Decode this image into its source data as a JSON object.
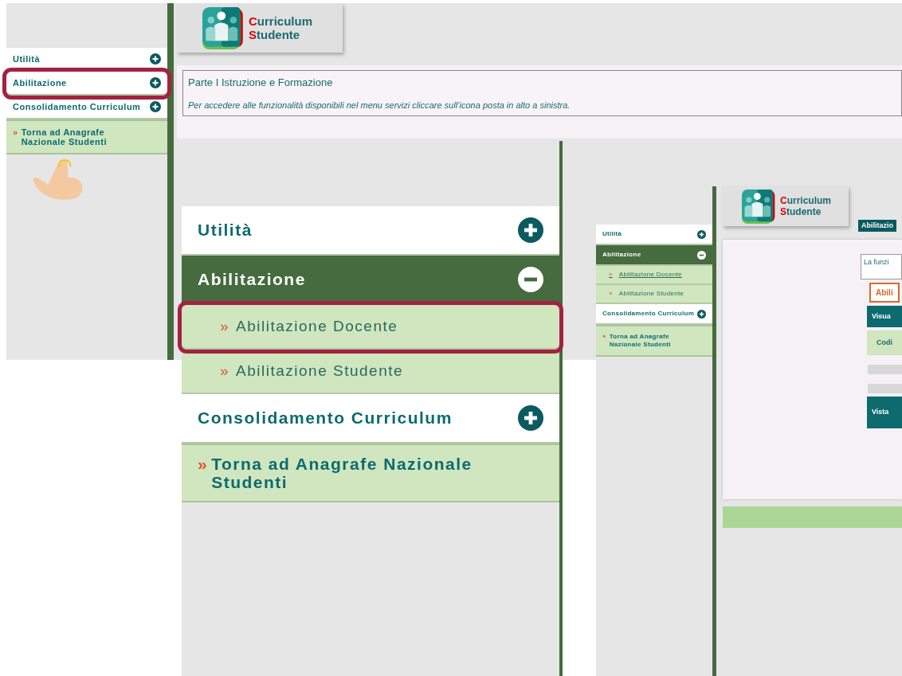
{
  "overview": {
    "logo_lines": [
      "Curriculum",
      "Studente"
    ],
    "menu": [
      {
        "kind": "section",
        "label": "Utilità",
        "expanded": false,
        "highlighted": false
      },
      {
        "kind": "section",
        "label": "Abilitazione",
        "expanded": false,
        "highlighted": true
      },
      {
        "kind": "section",
        "label": "Consolidamento Curriculum",
        "expanded": false,
        "highlighted": false
      },
      {
        "kind": "link",
        "marker": "»",
        "label": "Torna ad Anagrafe Nazionale Studenti",
        "highlighted": false
      }
    ],
    "notice": {
      "title": "Parte I Istruzione e Formazione",
      "text": "Per accedere alle funzionalità disponibili nel menu servizi cliccare sull’icona posta in alto a sinistra."
    }
  },
  "menu_zoom": {
    "menu": [
      {
        "kind": "section",
        "label": "Utilità",
        "expanded": false,
        "highlighted": false
      },
      {
        "kind": "section",
        "label": "Abilitazione",
        "expanded": true,
        "highlighted": false
      },
      {
        "kind": "subitem",
        "marker": "»",
        "label": "Abilitazione Docente",
        "selected": false,
        "highlighted": true
      },
      {
        "kind": "subitem",
        "marker": "»",
        "label": "Abilitazione Studente",
        "selected": false,
        "highlighted": false
      },
      {
        "kind": "section",
        "label": "Consolidamento Curriculum",
        "expanded": false,
        "highlighted": false
      },
      {
        "kind": "link",
        "marker": "»",
        "label": "Torna ad Anagrafe Nazionale Studenti",
        "highlighted": false
      }
    ]
  },
  "result": {
    "logo_lines": [
      "Curriculum",
      "Studente"
    ],
    "menu": [
      {
        "kind": "section",
        "label": "Utilità",
        "expanded": false,
        "highlighted": false
      },
      {
        "kind": "section",
        "label": "Abilitazione",
        "expanded": true,
        "highlighted": false
      },
      {
        "kind": "subitem",
        "marker": "»",
        "label": "Abilitazione Docente",
        "selected": true,
        "highlighted": false
      },
      {
        "kind": "subitem",
        "marker": "»",
        "label": "Abilitazione Studente",
        "selected": false,
        "highlighted": false
      },
      {
        "kind": "section",
        "label": "Consolidamento Curriculum",
        "expanded": false,
        "highlighted": false
      },
      {
        "kind": "link",
        "marker": "»",
        "label": "Torna ad Anagrafe Nazionale Studenti",
        "highlighted": false
      }
    ],
    "tag": "Abilitazio",
    "content_rows": [
      {
        "kind": "field",
        "text": "La funzi"
      },
      {
        "kind": "outline-button",
        "text": "Abili"
      },
      {
        "kind": "header",
        "text": "Visua"
      },
      {
        "kind": "row",
        "text": "Codi"
      },
      {
        "kind": "bar"
      },
      {
        "kind": "bar"
      },
      {
        "kind": "header",
        "text": "Vista"
      }
    ]
  }
}
